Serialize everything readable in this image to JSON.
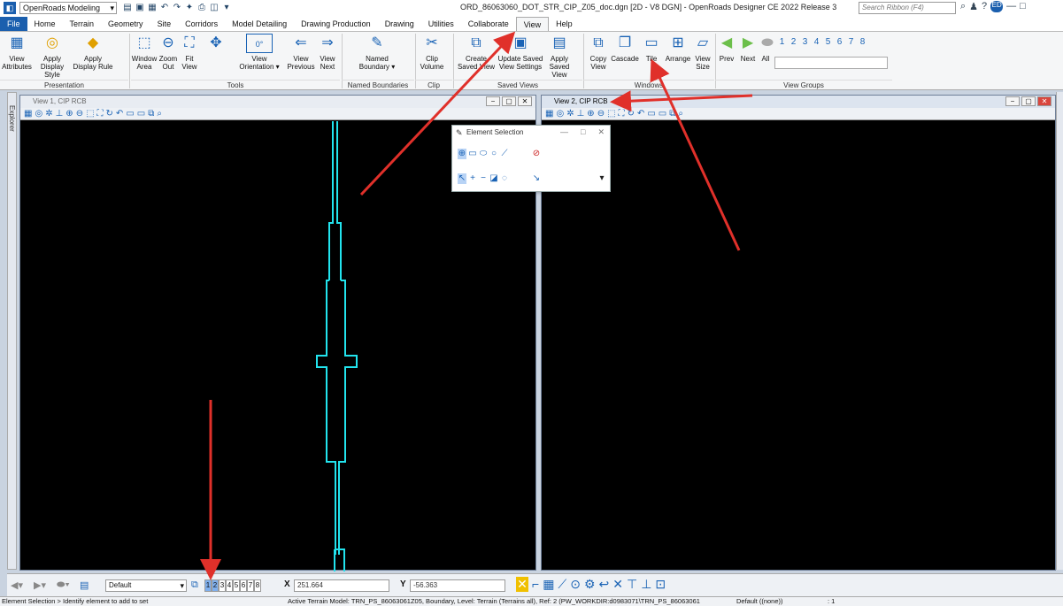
{
  "title_bar": {
    "workspace": "OpenRoads Modeling",
    "window_title": "ORD_86063060_DOT_STR_CIP_Z05_doc.dgn [2D - V8 DGN] - OpenRoads Designer CE 2022 Release 3",
    "search_placeholder": "Search Ribbon (F4)",
    "user_initials": "ED"
  },
  "tabs": [
    "File",
    "Home",
    "Terrain",
    "Geometry",
    "Site",
    "Corridors",
    "Model Detailing",
    "Drawing Production",
    "Drawing",
    "Utilities",
    "Collaborate",
    "View",
    "Help"
  ],
  "active_tab": "View",
  "ribbon": {
    "buttons": {
      "view_attributes": "View\nAttributes",
      "apply_display_style": "Apply\nDisplay Style",
      "apply_display_rule": "Apply\nDisplay Rule",
      "window_area": "Window\nArea",
      "zoom_out": "Zoom\nOut",
      "fit_view": "Fit\nView",
      "view_orientation": "View\nOrientation ▾",
      "view_previous": "View\nPrevious",
      "view_next": "View\nNext",
      "named_boundary": "Named\nBoundary ▾",
      "clip_volume": "Clip\nVolume",
      "create_saved_view": "Create\nSaved View",
      "update_saved_view": "Update Saved\nView Settings",
      "apply_saved_view": "Apply\nSaved View",
      "copy_view": "Copy\nView",
      "cascade": "Cascade",
      "tile": "Tile",
      "arrange": "Arrange",
      "view_size": "View\nSize",
      "prev": "Prev",
      "next": "Next",
      "all": "All"
    },
    "groups": {
      "presentation": "Presentation",
      "tools": "Tools",
      "named_boundaries": "Named Boundaries",
      "clip": "Clip",
      "saved_views": "Saved Views",
      "windows": "Windows",
      "view_groups": "View Groups"
    },
    "view_group_numbers": [
      "1",
      "2",
      "3",
      "4",
      "5",
      "6",
      "7",
      "8"
    ],
    "view_orientation_value": "0°"
  },
  "views": {
    "view1_title": "View 1, CIP RCB",
    "view2_title": "View 2, CIP RCB"
  },
  "explorer_label": "Explorer",
  "element_selection": {
    "title": "Element Selection"
  },
  "bottom_bar": {
    "view_group": "Default",
    "view_numbers": [
      "1",
      "2",
      "3",
      "4",
      "5",
      "6",
      "7",
      "8"
    ],
    "x_label": "X",
    "x_value": "251.664",
    "y_label": "Y",
    "y_value": "-56.363"
  },
  "status_bar": {
    "prompt": "Element Selection > Identify element to add to set",
    "message": "Active Terrain Model: TRN_PS_86063061Z05, Boundary, Level: Terrain (Terrains all), Ref: 2 (PW_WORKDIR:d0983071\\TRN_PS_86063061",
    "level": "Default ((none))",
    "selection_count": ": 1"
  },
  "colors": {
    "accent": "#1b5fae",
    "geometry": "#22e4ee",
    "annotation_arrow": "#e0302a"
  }
}
